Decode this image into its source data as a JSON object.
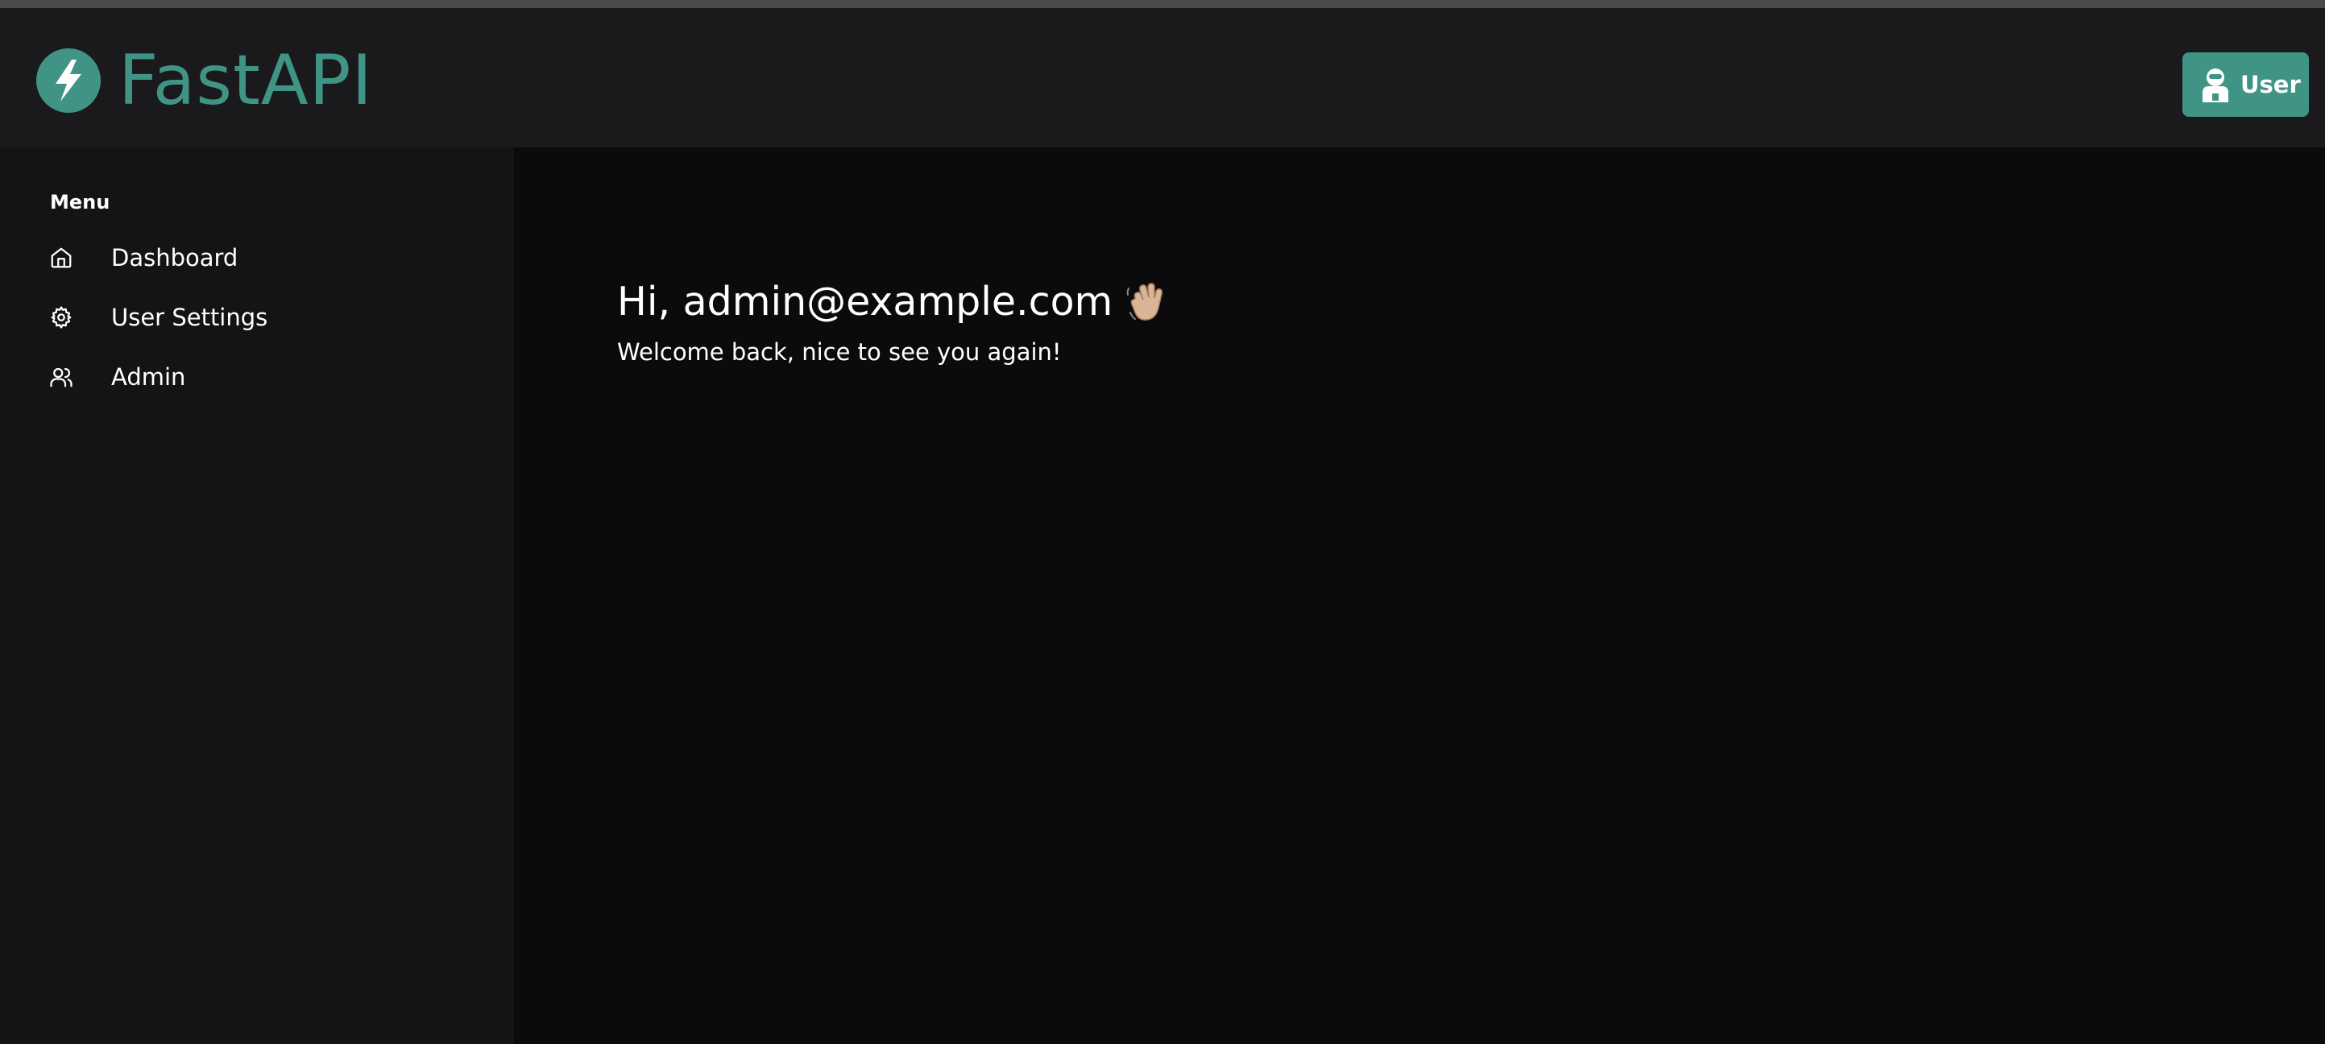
{
  "header": {
    "logo_text": "FastAPI",
    "user_button_label": "User"
  },
  "sidebar": {
    "heading": "Menu",
    "items": [
      {
        "label": "Dashboard",
        "icon": "home-icon"
      },
      {
        "label": "User Settings",
        "icon": "settings-icon"
      },
      {
        "label": "Admin",
        "icon": "users-icon"
      }
    ]
  },
  "main": {
    "greeting": "Hi, admin@example.com",
    "greeting_icon": "waving-hand-icon",
    "welcome": "Welcome back, nice to see you again!"
  },
  "colors": {
    "accent": "#409486",
    "header_bg": "#1a1a1c",
    "sidebar_bg": "#141415",
    "main_bg": "#0b0b0d",
    "text": "#ffffff"
  }
}
